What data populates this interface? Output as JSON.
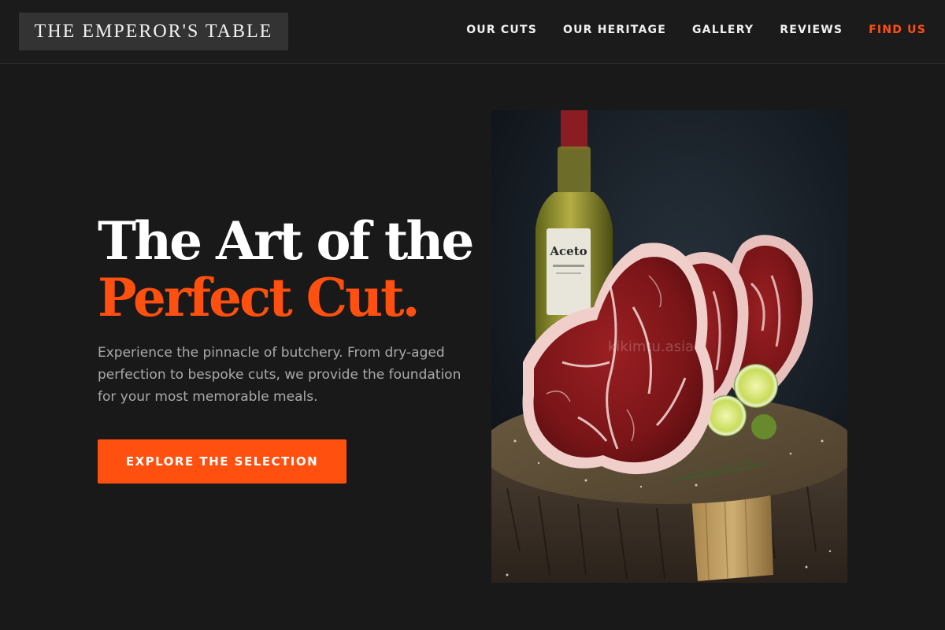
{
  "header": {
    "logo": "THE EMPEROR'S TABLE",
    "nav": [
      {
        "label": "OUR CUTS"
      },
      {
        "label": "OUR HERITAGE"
      },
      {
        "label": "GALLERY"
      },
      {
        "label": "REVIEWS"
      },
      {
        "label": "FIND US"
      }
    ]
  },
  "hero": {
    "title_line1": "The Art of the",
    "title_line2": "Perfect Cut.",
    "description": "Experience the pinnacle of butchery. From dry-aged perfection to bespoke cuts, we provide the foundation for your most memorable meals.",
    "cta_label": "EXPLORE THE SELECTION",
    "image": {
      "bottle_label": "Aceto",
      "watermark": "kikimtu.asia"
    }
  },
  "colors": {
    "background": "#191919",
    "header_background": "#1b1b1b",
    "logo_background": "#333333",
    "accent": "#ff5010",
    "text_primary": "#ffffff",
    "text_secondary": "#a9a9a9"
  }
}
